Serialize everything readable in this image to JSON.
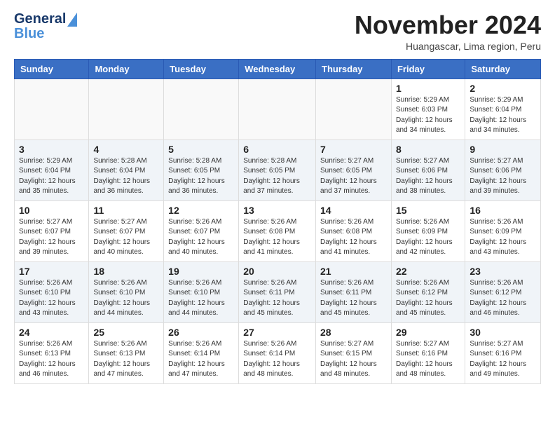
{
  "header": {
    "logo_general": "General",
    "logo_blue": "Blue",
    "month_title": "November 2024",
    "location": "Huangascar, Lima region, Peru"
  },
  "calendar": {
    "days_of_week": [
      "Sunday",
      "Monday",
      "Tuesday",
      "Wednesday",
      "Thursday",
      "Friday",
      "Saturday"
    ],
    "weeks": [
      [
        {
          "day": "",
          "info": ""
        },
        {
          "day": "",
          "info": ""
        },
        {
          "day": "",
          "info": ""
        },
        {
          "day": "",
          "info": ""
        },
        {
          "day": "",
          "info": ""
        },
        {
          "day": "1",
          "info": "Sunrise: 5:29 AM\nSunset: 6:03 PM\nDaylight: 12 hours\nand 34 minutes."
        },
        {
          "day": "2",
          "info": "Sunrise: 5:29 AM\nSunset: 6:04 PM\nDaylight: 12 hours\nand 34 minutes."
        }
      ],
      [
        {
          "day": "3",
          "info": "Sunrise: 5:29 AM\nSunset: 6:04 PM\nDaylight: 12 hours\nand 35 minutes."
        },
        {
          "day": "4",
          "info": "Sunrise: 5:28 AM\nSunset: 6:04 PM\nDaylight: 12 hours\nand 36 minutes."
        },
        {
          "day": "5",
          "info": "Sunrise: 5:28 AM\nSunset: 6:05 PM\nDaylight: 12 hours\nand 36 minutes."
        },
        {
          "day": "6",
          "info": "Sunrise: 5:28 AM\nSunset: 6:05 PM\nDaylight: 12 hours\nand 37 minutes."
        },
        {
          "day": "7",
          "info": "Sunrise: 5:27 AM\nSunset: 6:05 PM\nDaylight: 12 hours\nand 37 minutes."
        },
        {
          "day": "8",
          "info": "Sunrise: 5:27 AM\nSunset: 6:06 PM\nDaylight: 12 hours\nand 38 minutes."
        },
        {
          "day": "9",
          "info": "Sunrise: 5:27 AM\nSunset: 6:06 PM\nDaylight: 12 hours\nand 39 minutes."
        }
      ],
      [
        {
          "day": "10",
          "info": "Sunrise: 5:27 AM\nSunset: 6:07 PM\nDaylight: 12 hours\nand 39 minutes."
        },
        {
          "day": "11",
          "info": "Sunrise: 5:27 AM\nSunset: 6:07 PM\nDaylight: 12 hours\nand 40 minutes."
        },
        {
          "day": "12",
          "info": "Sunrise: 5:26 AM\nSunset: 6:07 PM\nDaylight: 12 hours\nand 40 minutes."
        },
        {
          "day": "13",
          "info": "Sunrise: 5:26 AM\nSunset: 6:08 PM\nDaylight: 12 hours\nand 41 minutes."
        },
        {
          "day": "14",
          "info": "Sunrise: 5:26 AM\nSunset: 6:08 PM\nDaylight: 12 hours\nand 41 minutes."
        },
        {
          "day": "15",
          "info": "Sunrise: 5:26 AM\nSunset: 6:09 PM\nDaylight: 12 hours\nand 42 minutes."
        },
        {
          "day": "16",
          "info": "Sunrise: 5:26 AM\nSunset: 6:09 PM\nDaylight: 12 hours\nand 43 minutes."
        }
      ],
      [
        {
          "day": "17",
          "info": "Sunrise: 5:26 AM\nSunset: 6:10 PM\nDaylight: 12 hours\nand 43 minutes."
        },
        {
          "day": "18",
          "info": "Sunrise: 5:26 AM\nSunset: 6:10 PM\nDaylight: 12 hours\nand 44 minutes."
        },
        {
          "day": "19",
          "info": "Sunrise: 5:26 AM\nSunset: 6:10 PM\nDaylight: 12 hours\nand 44 minutes."
        },
        {
          "day": "20",
          "info": "Sunrise: 5:26 AM\nSunset: 6:11 PM\nDaylight: 12 hours\nand 45 minutes."
        },
        {
          "day": "21",
          "info": "Sunrise: 5:26 AM\nSunset: 6:11 PM\nDaylight: 12 hours\nand 45 minutes."
        },
        {
          "day": "22",
          "info": "Sunrise: 5:26 AM\nSunset: 6:12 PM\nDaylight: 12 hours\nand 45 minutes."
        },
        {
          "day": "23",
          "info": "Sunrise: 5:26 AM\nSunset: 6:12 PM\nDaylight: 12 hours\nand 46 minutes."
        }
      ],
      [
        {
          "day": "24",
          "info": "Sunrise: 5:26 AM\nSunset: 6:13 PM\nDaylight: 12 hours\nand 46 minutes."
        },
        {
          "day": "25",
          "info": "Sunrise: 5:26 AM\nSunset: 6:13 PM\nDaylight: 12 hours\nand 47 minutes."
        },
        {
          "day": "26",
          "info": "Sunrise: 5:26 AM\nSunset: 6:14 PM\nDaylight: 12 hours\nand 47 minutes."
        },
        {
          "day": "27",
          "info": "Sunrise: 5:26 AM\nSunset: 6:14 PM\nDaylight: 12 hours\nand 48 minutes."
        },
        {
          "day": "28",
          "info": "Sunrise: 5:27 AM\nSunset: 6:15 PM\nDaylight: 12 hours\nand 48 minutes."
        },
        {
          "day": "29",
          "info": "Sunrise: 5:27 AM\nSunset: 6:16 PM\nDaylight: 12 hours\nand 48 minutes."
        },
        {
          "day": "30",
          "info": "Sunrise: 5:27 AM\nSunset: 6:16 PM\nDaylight: 12 hours\nand 49 minutes."
        }
      ]
    ]
  }
}
